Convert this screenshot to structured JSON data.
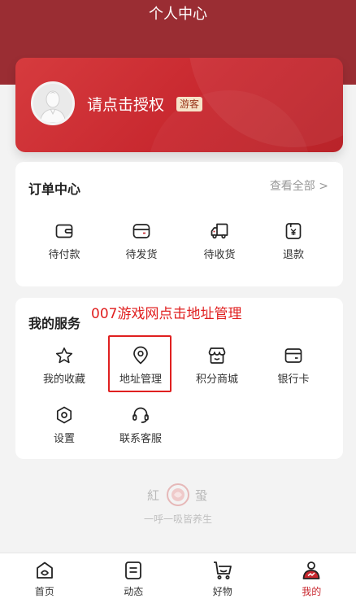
{
  "header": {
    "title": "个人中心"
  },
  "user_card": {
    "auth_text": "请点击授权",
    "badge": "游客"
  },
  "orders": {
    "title": "订单中心",
    "view_all": "查看全部 >",
    "items": [
      {
        "label": "待付款",
        "icon": "wallet-icon"
      },
      {
        "label": "待发货",
        "icon": "box-icon"
      },
      {
        "label": "待收货",
        "icon": "truck-icon"
      },
      {
        "label": "退款",
        "icon": "refund-icon"
      }
    ]
  },
  "services": {
    "title": "我的服务",
    "items": [
      {
        "label": "我的收藏",
        "icon": "star-icon"
      },
      {
        "label": "地址管理",
        "icon": "location-pin-icon"
      },
      {
        "label": "积分商城",
        "icon": "store-icon"
      },
      {
        "label": "银行卡",
        "icon": "bank-card-icon"
      },
      {
        "label": "设置",
        "icon": "settings-icon"
      },
      {
        "label": "联系客服",
        "icon": "headset-icon"
      }
    ]
  },
  "annotation": {
    "text": "007游戏网点击地址管理",
    "color": "#e02020"
  },
  "brand": {
    "name_left": "紅",
    "name_right": "蛩",
    "slogan": "一呼一吸皆养生"
  },
  "tabbar": {
    "tabs": [
      {
        "label": "首页",
        "icon": "home-icon",
        "active": false
      },
      {
        "label": "动态",
        "icon": "news-icon",
        "active": false
      },
      {
        "label": "好物",
        "icon": "cart-icon",
        "active": false
      },
      {
        "label": "我的",
        "icon": "profile-icon",
        "active": true
      }
    ]
  },
  "colors": {
    "primary": "#c8282f",
    "header_bg": "#9a2d33",
    "badge_bg": "#f6e3c8"
  }
}
